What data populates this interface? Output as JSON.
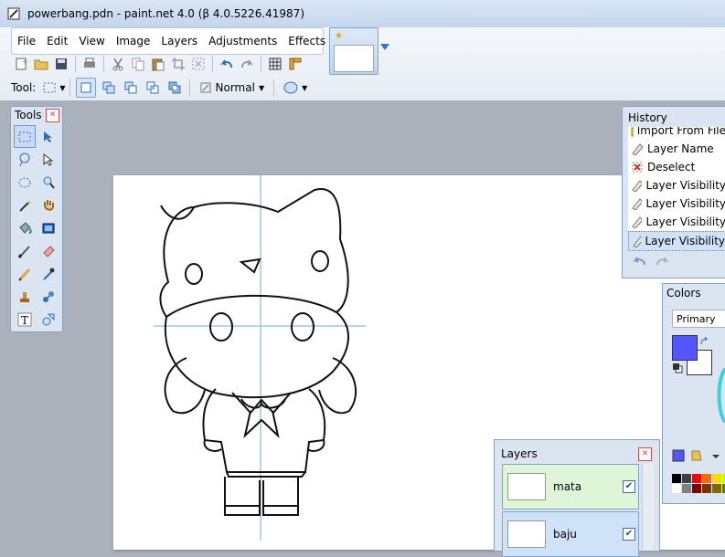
{
  "window": {
    "title": "powerbang.pdn - paint.net 4.0 (β 4.0.5226.41987)"
  },
  "menu": {
    "items": [
      "File",
      "Edit",
      "View",
      "Image",
      "Layers",
      "Adjustments",
      "Effects"
    ]
  },
  "toolbar": {
    "tool_label": "Tool:",
    "blend_mode": "Normal"
  },
  "tools_window": {
    "title": "Tools"
  },
  "history_window": {
    "title": "History",
    "items": [
      "Import From File",
      "Layer Name",
      "Deselect",
      "Layer Visibility",
      "Layer Visibility",
      "Layer Visibility",
      "Layer Visibility"
    ]
  },
  "colors_window": {
    "title": "Colors",
    "selector": "Primary",
    "primary_color": "#5555ff",
    "secondary_color": "#ffffff"
  },
  "layers_window": {
    "title": "Layers",
    "layers": [
      {
        "name": "mata",
        "visible": true
      },
      {
        "name": "baju",
        "visible": true
      }
    ]
  }
}
